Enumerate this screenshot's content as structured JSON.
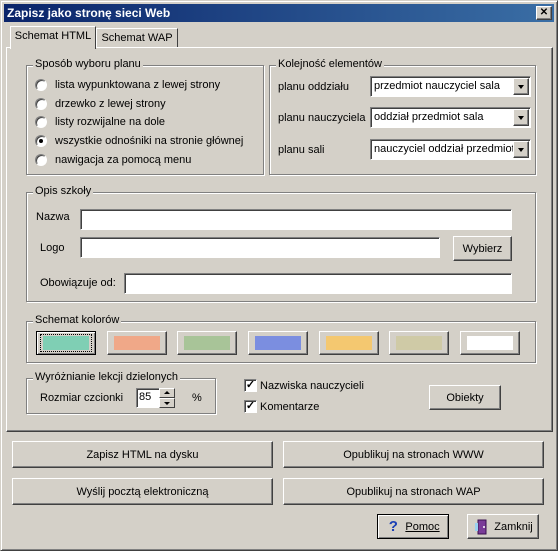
{
  "window": {
    "title": "Zapisz jako stronę sieci Web",
    "close_symbol": "✕"
  },
  "tabs": [
    {
      "label": "Schemat HTML",
      "active": true
    },
    {
      "label": "Schemat WAP",
      "active": false
    }
  ],
  "plan_selection": {
    "legend": "Sposób wyboru planu",
    "options": [
      {
        "label": "lista wypunktowana z lewej strony",
        "selected": false
      },
      {
        "label": "drzewko z lewej strony",
        "selected": false
      },
      {
        "label": "listy rozwijalne na dole",
        "selected": false
      },
      {
        "label": "wszystkie odnośniki na stronie głównej",
        "selected": true
      },
      {
        "label": "nawigacja za pomocą menu",
        "selected": false
      }
    ]
  },
  "element_order": {
    "legend": "Kolejność elementów",
    "rows": [
      {
        "label": "planu oddziału",
        "value": "przedmiot nauczyciel sala"
      },
      {
        "label": "planu nauczyciela",
        "value": "oddział przedmiot sala"
      },
      {
        "label": "planu sali",
        "value": "nauczyciel oddział przedmiot"
      }
    ]
  },
  "school_description": {
    "legend": "Opis szkoły",
    "name_label": "Nazwa",
    "name_value": "",
    "logo_label": "Logo",
    "logo_value": "",
    "browse_button": "Wybierz",
    "valid_from_label": "Obowiązuje od:",
    "valid_from_value": ""
  },
  "color_scheme": {
    "legend": "Schemat kolorów",
    "swatches": [
      {
        "color": "#7fcfb4",
        "selected": true
      },
      {
        "color": "#f0a888",
        "selected": false
      },
      {
        "color": "#a8c498",
        "selected": false
      },
      {
        "color": "#7b8ee0",
        "selected": false
      },
      {
        "color": "#f4c870",
        "selected": false
      },
      {
        "color": "#cfcaa6",
        "selected": false
      },
      {
        "color": "#ffffff",
        "selected": false
      }
    ]
  },
  "split_lessons": {
    "legend": "Wyróżnianie lekcji dzielonych",
    "font_size_label": "Rozmiar czcionki",
    "font_size_value": "85",
    "unit": "%"
  },
  "options": {
    "teacher_names_label": "Nazwiska nauczycieli",
    "teacher_names_checked": true,
    "comments_label": "Komentarze",
    "comments_checked": true,
    "objects_button": "Obiekty"
  },
  "actions": {
    "save_html": "Zapisz HTML na dysku",
    "publish_www": "Opublikuj na stronach WWW",
    "send_email": "Wyślij pocztą elektroniczną",
    "publish_wap": "Opublikuj na stronach WAP",
    "help": "Pomoc",
    "close": "Zamknij"
  }
}
